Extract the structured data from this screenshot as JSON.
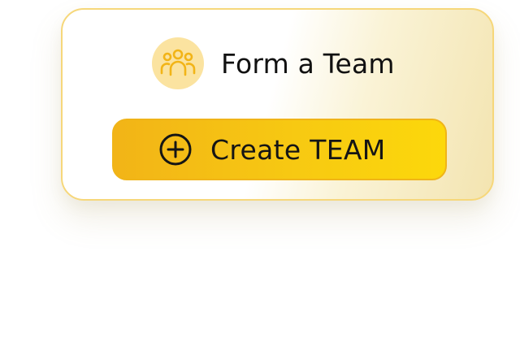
{
  "card": {
    "title": "Form a Team",
    "icon": "team-people-icon"
  },
  "button": {
    "label": "Create TEAM",
    "icon": "plus-circle-icon"
  },
  "colors": {
    "accent": "#f7c912",
    "icon_bg": "#fbe3a0",
    "icon_fg": "#f2b417",
    "border": "#f6d77a",
    "text": "#111111"
  }
}
